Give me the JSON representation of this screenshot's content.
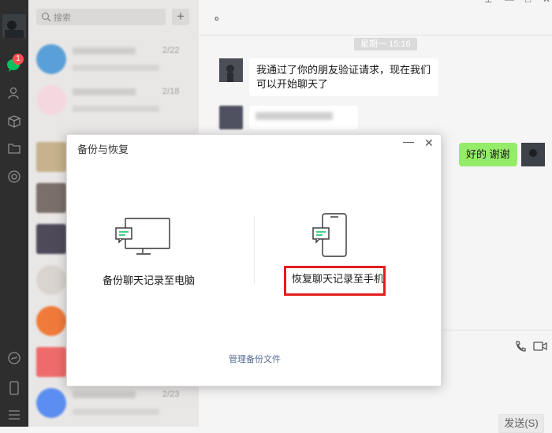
{
  "sidebar": {
    "unread_badge": "1",
    "icons": [
      "chat-icon",
      "contacts-icon",
      "box-icon",
      "folder-icon",
      "moments-icon",
      "mini-program-icon",
      "phone-icon",
      "menu-icon"
    ]
  },
  "search": {
    "placeholder": "搜索"
  },
  "chat_list": {
    "dates": [
      "2/22",
      "2/18",
      "2/23"
    ]
  },
  "chat": {
    "title": "。",
    "timestamp": "星期一 15:16",
    "messages": [
      {
        "from": "contact",
        "text": "我通过了你的朋友验证请求，现在我们可以开始聊天了"
      },
      {
        "from": "me",
        "text": "好的 谢谢"
      }
    ],
    "send_label": "发送(S)"
  },
  "dialog": {
    "title": "备份与恢复",
    "option_pc": "备份聊天记录至电脑",
    "option_phone": "恢复聊天记录至手机",
    "manage_link": "管理备份文件"
  },
  "colors": {
    "highlight": "#e51c1c",
    "my_bubble": "#95ec69",
    "accent_green": "#07c160",
    "link": "#576b95"
  }
}
